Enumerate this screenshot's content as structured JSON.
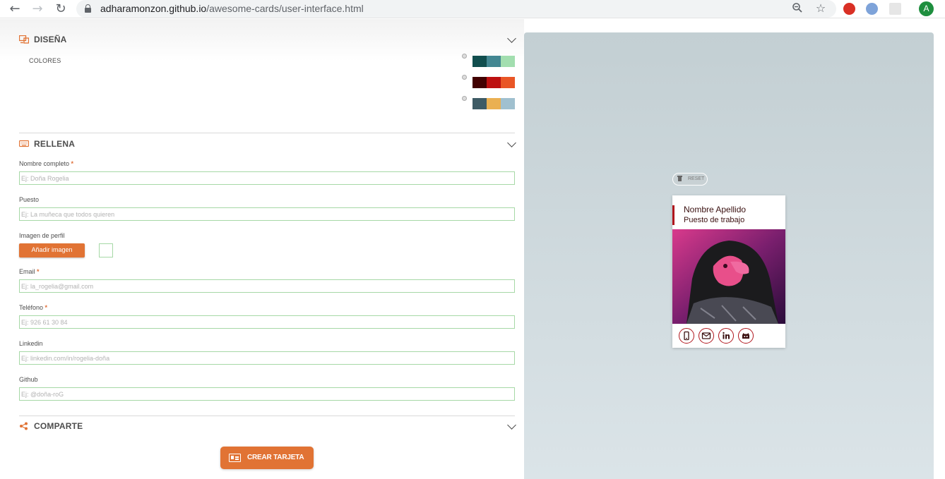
{
  "browser": {
    "back_icon": "arrow-left-icon",
    "forward_icon": "arrow-right-icon",
    "reload_icon": "reload-icon",
    "url_host": "adharamonzon.github.io",
    "url_path": "/awesome-cards/user-interface.html",
    "profile_initial": "A"
  },
  "sections": {
    "design": {
      "title": "DISEÑA",
      "icon": "design-icon"
    },
    "fill": {
      "title": "RELLENA",
      "icon": "keyboard-icon"
    },
    "share": {
      "title": "COMPARTE",
      "icon": "share-icon"
    }
  },
  "design": {
    "colors_label": "COLORES",
    "palettes": [
      {
        "colors": [
          "#114e4e",
          "#438792",
          "#a2deaf"
        ]
      },
      {
        "colors": [
          "#420101",
          "#bd1010",
          "#e95626"
        ]
      },
      {
        "colors": [
          "#3e5b65",
          "#eab052",
          "#a0c0cf"
        ]
      }
    ]
  },
  "form": {
    "fields": [
      {
        "label": "Nombre completo",
        "required": "*",
        "placeholder": "Ej: Doña Rogelia"
      },
      {
        "label": "Puesto",
        "required": "",
        "placeholder": "Ej: La muñeca que todos quieren"
      },
      {
        "label": "Imagen de perfil",
        "required": ""
      },
      {
        "label": "Email",
        "required": "*",
        "placeholder": "Ej: la_rogelia@gmail.com"
      },
      {
        "label": "Teléfono",
        "required": "*",
        "placeholder": "Ej: 926 61 30 84"
      },
      {
        "label": "Linkedin",
        "required": "",
        "placeholder": "Ej: linkedin.com/in/rogelia-doña"
      },
      {
        "label": "Github",
        "required": "",
        "placeholder": "Ej: @doña-roG"
      }
    ],
    "add_image_label": "Añadir imagen"
  },
  "share": {
    "create_label": "CREAR TARJETA"
  },
  "preview": {
    "reset_label": "RESET",
    "card": {
      "name": "Nombre Apellido",
      "job": "Puesto de trabajo",
      "accent_color": "#b0161d",
      "social_icons": [
        "mobile-icon",
        "email-icon",
        "linkedin-icon",
        "github-icon"
      ]
    }
  },
  "colors": {
    "accent": "#e17334",
    "input_border": "#a6d8a6",
    "preview_bg_top": "#c3cfd3",
    "preview_bg_bottom": "#dbe4e8"
  }
}
